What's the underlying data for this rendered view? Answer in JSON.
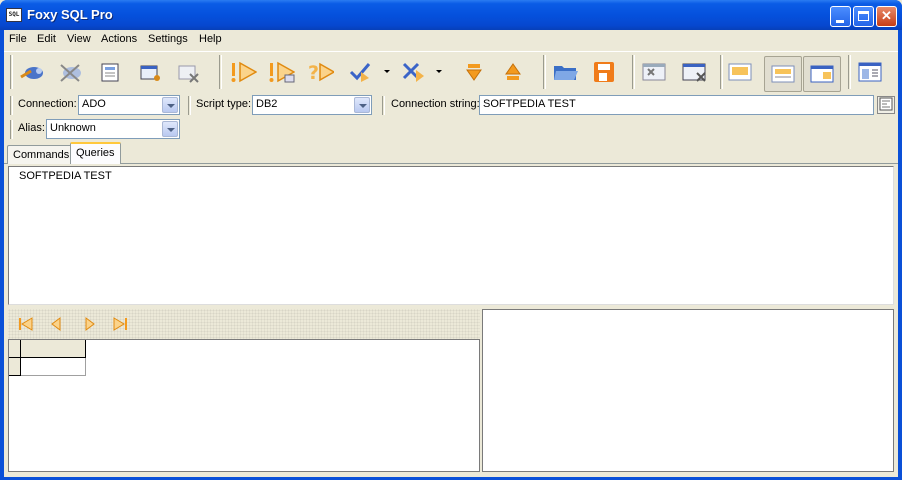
{
  "window": {
    "title": "Foxy SQL Pro"
  },
  "menu": [
    "File",
    "Edit",
    "View",
    "Actions",
    "Settings",
    "Help"
  ],
  "toolbar_icons": [
    "connect-icon",
    "disconnect-icon",
    "properties-icon",
    "new-connection-icon",
    "remove-connection-icon",
    "execute-icon",
    "execute-step-icon",
    "help-execute-icon",
    "commit-icon",
    "rollback-icon",
    "move-down-icon",
    "move-up-icon",
    "open-folder-icon",
    "save-icon",
    "clear-icon",
    "close-result-icon",
    "layout-1-icon",
    "layout-2-icon",
    "layout-3-icon",
    "panel-icon"
  ],
  "connection_bar": {
    "connection_label": "Connection:",
    "connection_value": "ADO",
    "script_type_label": "Script type:",
    "script_type_value": "DB2",
    "connection_string_label": "Connection string:",
    "connection_string_value": "SOFTPEDIA TEST",
    "alias_label": "Alias:",
    "alias_value": "Unknown"
  },
  "tabs": [
    {
      "label": "Commands"
    },
    {
      "label": "Queries"
    }
  ],
  "editor": {
    "text": "SOFTPEDIA TEST"
  },
  "colors": {
    "title_bar": "#0551dd",
    "accent_orange": "#f39a1e",
    "tab_highlight": "#ffc83c"
  }
}
